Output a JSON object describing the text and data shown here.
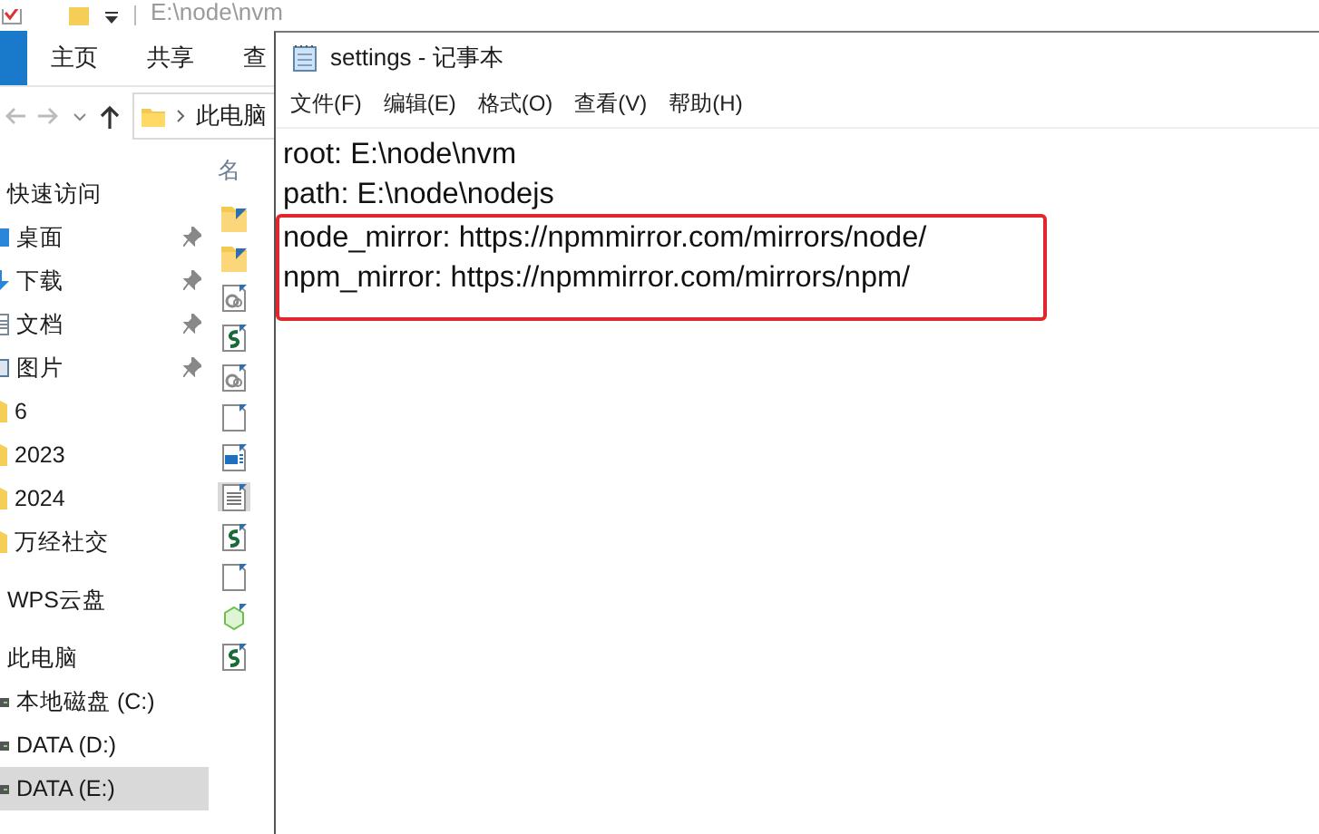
{
  "explorer": {
    "path": "E:\\node\\nvm",
    "ribbon_tabs": [
      {
        "label": "主页",
        "selected": false
      },
      {
        "label": "共享",
        "selected": false
      },
      {
        "label": "查",
        "selected": false
      }
    ],
    "address": {
      "crumb": "此电脑"
    },
    "column_header": "名",
    "sidebar": [
      {
        "kind": "header",
        "label": "快速访问",
        "selected": false
      },
      {
        "kind": "desktop",
        "label": "桌面",
        "pinned": true,
        "selected": false
      },
      {
        "kind": "download",
        "label": "下载",
        "pinned": true,
        "selected": false
      },
      {
        "kind": "document",
        "label": "文档",
        "pinned": true,
        "selected": false
      },
      {
        "kind": "picture",
        "label": "图片",
        "pinned": true,
        "selected": false
      },
      {
        "kind": "folder",
        "label": "6",
        "pinned": false,
        "selected": false
      },
      {
        "kind": "folder",
        "label": "2023",
        "pinned": false,
        "selected": false
      },
      {
        "kind": "folder",
        "label": "2024",
        "pinned": false,
        "selected": false
      },
      {
        "kind": "folder",
        "label": "万经社交",
        "pinned": false,
        "selected": false
      },
      {
        "kind": "header",
        "label": "WPS云盘",
        "selected": false
      },
      {
        "kind": "header",
        "label": "此电脑",
        "selected": false
      },
      {
        "kind": "drive",
        "label": "本地磁盘 (C:)",
        "selected": false
      },
      {
        "kind": "drive",
        "label": "DATA (D:)",
        "selected": false
      },
      {
        "kind": "drive",
        "label": "DATA (E:)",
        "selected": true
      }
    ],
    "files": [
      {
        "kind": "folder",
        "selected": false
      },
      {
        "kind": "folder",
        "selected": false
      },
      {
        "kind": "settings",
        "selected": false
      },
      {
        "kind": "exe",
        "selected": false
      },
      {
        "kind": "settings",
        "selected": false
      },
      {
        "kind": "file",
        "selected": false
      },
      {
        "kind": "app",
        "selected": false
      },
      {
        "kind": "text",
        "selected": true
      },
      {
        "kind": "exe",
        "selected": false
      },
      {
        "kind": "file",
        "selected": false
      },
      {
        "kind": "shell",
        "selected": false
      },
      {
        "kind": "exe",
        "selected": false
      }
    ]
  },
  "notepad": {
    "title": "settings - 记事本",
    "menu": [
      "文件(F)",
      "编辑(E)",
      "格式(O)",
      "查看(V)",
      "帮助(H)"
    ],
    "lines": [
      {
        "text": "root: E:\\node\\nvm",
        "highlighted": false
      },
      {
        "text": "path: E:\\node\\nodejs",
        "highlighted": false
      },
      {
        "text": "node_mirror: https://npmmirror.com/mirrors/node/",
        "highlighted": true
      },
      {
        "text": "npm_mirror: https://npmmirror.com/mirrors/npm/",
        "highlighted": true
      }
    ]
  }
}
